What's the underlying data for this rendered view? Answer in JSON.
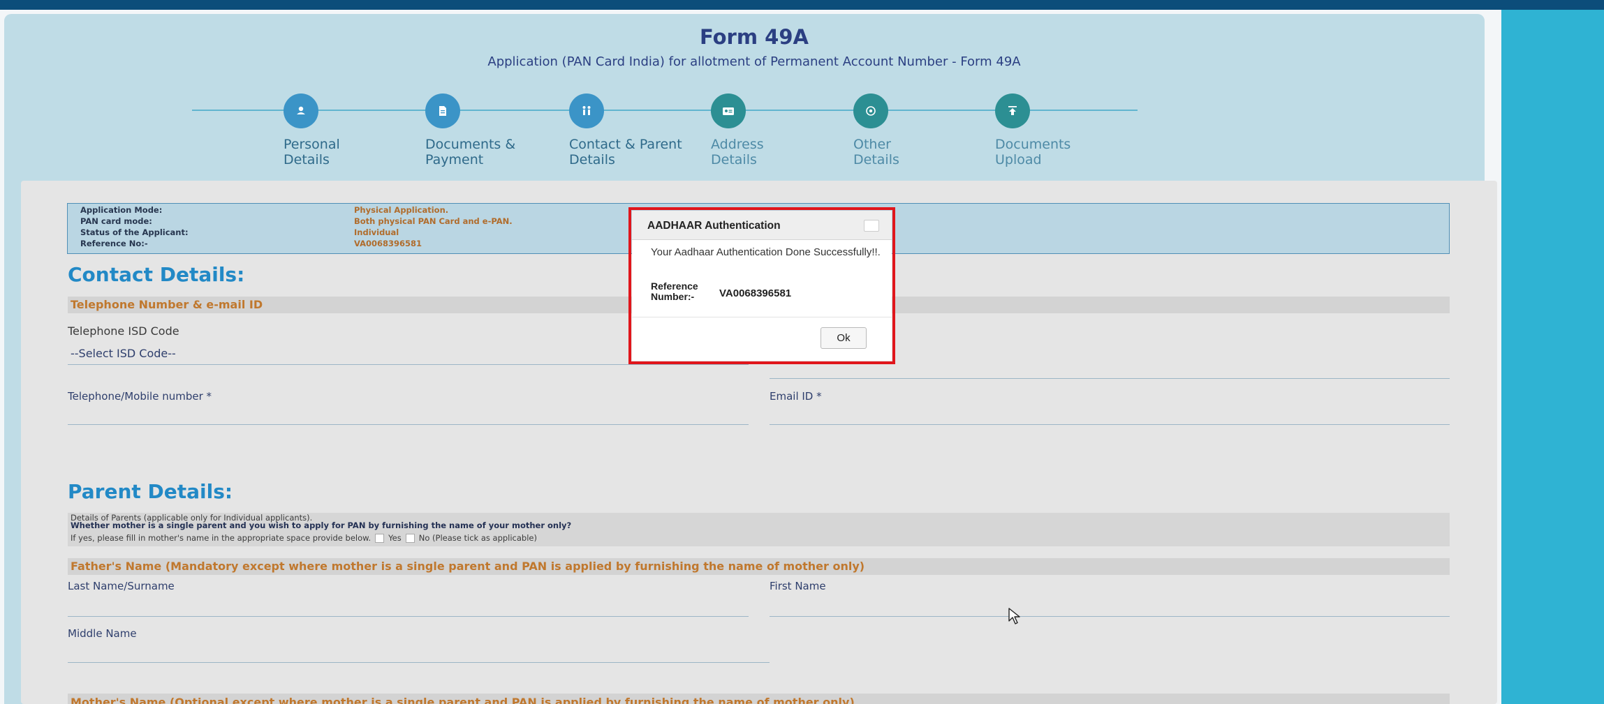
{
  "header": {
    "title": "Form 49A",
    "subtitle": "Application (PAN Card India) for allotment of Permanent Account Number - Form 49A"
  },
  "stepper": {
    "steps": [
      {
        "label_line1": "Personal",
        "label_line2": "Details",
        "icon": "user-icon",
        "status": "done"
      },
      {
        "label_line1": "Documents &",
        "label_line2": "Payment",
        "icon": "document-icon",
        "status": "done"
      },
      {
        "label_line1": "Contact & Parent",
        "label_line2": "Details",
        "icon": "family-icon",
        "status": "active"
      },
      {
        "label_line1": "Address",
        "label_line2": "Details",
        "icon": "id-card-icon",
        "status": "pending"
      },
      {
        "label_line1": "Other",
        "label_line2": "Details",
        "icon": "target-icon",
        "status": "pending"
      },
      {
        "label_line1": "Documents",
        "label_line2": "Upload",
        "icon": "upload-icon",
        "status": "pending"
      }
    ],
    "colors": {
      "done": "#3b94c7",
      "pending": "#2c8f93"
    }
  },
  "info": {
    "rows": [
      {
        "label": "Application Mode:",
        "value": "Physical Application."
      },
      {
        "label": "PAN card mode:",
        "value": "Both physical PAN Card and e-PAN."
      },
      {
        "label": "Status of the Applicant:",
        "value": "Individual"
      },
      {
        "label": "Reference No:-",
        "value": "VA0068396581"
      }
    ]
  },
  "contact": {
    "title": "Contact Details:",
    "bar_label": "Telephone Number & e-mail ID",
    "isd_label": "Telephone ISD Code",
    "isd_value": "--Select ISD Code--",
    "phone_label": "Telephone/Mobile number *",
    "email_label": "Email ID *"
  },
  "parent": {
    "title": "Parent Details:",
    "info_line1": "Details of Parents (applicable only for Individual applicants).",
    "info_line2": "Whether mother is a single parent and you wish to apply for PAN by furnishing the name of your mother only?",
    "info_line3": "If yes, please fill in mother's name in the appropriate space provide below.",
    "yes_label": "Yes",
    "no_label": "No (Please tick as applicable)",
    "father_bar": "Father's Name (Mandatory except where mother is a single parent and PAN is applied by furnishing the name of mother only)",
    "last_name_label": "Last Name/Surname",
    "first_name_label": "First Name",
    "middle_name_label": "Middle Name",
    "mother_bar": "Mother's Name (Optional except where mother is a single parent and PAN is applied by furnishing the name of mother only)"
  },
  "modal": {
    "title": "AADHAAR Authentication",
    "message": "Your Aadhaar Authentication Done Successfully!!.",
    "ref_label_line1": "Reference",
    "ref_label_line2": "Number:-",
    "ref_value": "VA0068396581",
    "ok_label": "Ok",
    "highlight_color": "#e0161c"
  }
}
